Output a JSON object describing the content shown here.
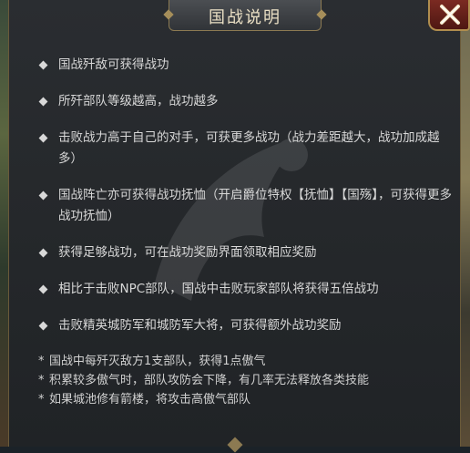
{
  "dialog": {
    "title": "国战说明",
    "rules": [
      "国战歼敌可获得战功",
      "所歼部队等级越高，战功越多",
      "击败战力高于自己的对手，可获更多战功（战力差距越大，战功加成越多）",
      "国战阵亡亦可获得战功抚恤（开启爵位特权【抚恤】【国殇】，可获得更多战功抚恤）",
      "获得足够战功，可在战功奖励界面领取相应奖励",
      "相比于击败NPC部队，国战中击败玩家部队将获得五倍战功",
      "击败精英城防军和城防军大将，可获得额外战功奖励"
    ],
    "notes_marker": "*",
    "notes": [
      "国战中每歼灭敌方1支部队，获得1点傲气",
      "积累较多傲气时，部队攻防会下降，有几率无法释放各类技能",
      "如果城池修有箭楼，将攻击高傲气部队"
    ]
  },
  "icons": {
    "close": "close-x-icon",
    "bullet": "diamond-bullet-icon"
  },
  "colors": {
    "panel": "#25282b",
    "text": "#d8d8d8",
    "title": "#eadfc4",
    "close": "#7b2a22",
    "gold": "#b08d4e"
  }
}
